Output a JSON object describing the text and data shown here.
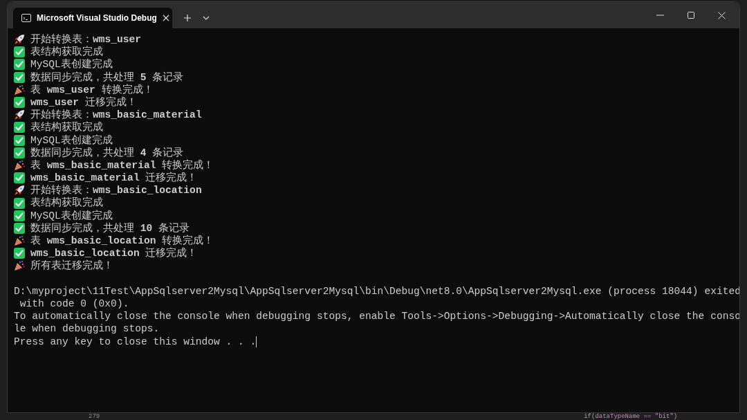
{
  "window": {
    "tab": {
      "title": "Microsoft Visual Studio Debug",
      "selected": true
    }
  },
  "console": {
    "lines": [
      {
        "kind": "rocket",
        "text": "开始转换表：**wms_user**"
      },
      {
        "kind": "check",
        "text": "表结构获取完成"
      },
      {
        "kind": "check",
        "text": "MySQL表创建完成"
      },
      {
        "kind": "check",
        "text": "数据同步完成，共处理 **5** 条记录"
      },
      {
        "kind": "party",
        "text": "表 **wms_user** 转换完成！"
      },
      {
        "kind": "check",
        "text": "**wms_user** 迁移完成！"
      },
      {
        "kind": "rocket",
        "text": "开始转换表：**wms_basic_material**"
      },
      {
        "kind": "check",
        "text": "表结构获取完成"
      },
      {
        "kind": "check",
        "text": "MySQL表创建完成"
      },
      {
        "kind": "check",
        "text": "数据同步完成，共处理 **4** 条记录"
      },
      {
        "kind": "party",
        "text": "表 **wms_basic_material** 转换完成！"
      },
      {
        "kind": "check",
        "text": "**wms_basic_material** 迁移完成！"
      },
      {
        "kind": "rocket",
        "text": "开始转换表：**wms_basic_location**"
      },
      {
        "kind": "check",
        "text": "表结构获取完成"
      },
      {
        "kind": "check",
        "text": "MySQL表创建完成"
      },
      {
        "kind": "check",
        "text": "数据同步完成，共处理 **10** 条记录"
      },
      {
        "kind": "party",
        "text": "表 **wms_basic_location** 转换完成！"
      },
      {
        "kind": "check",
        "text": "**wms_basic_location** 迁移完成！"
      },
      {
        "kind": "party",
        "text": "所有表迁移完成！"
      }
    ],
    "exit_lines": [
      "D:\\myproject\\11Test\\AppSqlserver2Mysql\\AppSqlserver2Mysql\\bin\\Debug\\net8.0\\AppSqlserver2Mysql.exe (process 18044) exited",
      " with code 0 (0x0).",
      "To automatically close the console when debugging stops, enable Tools->Options->Debugging->Automatically close the conso",
      "le when debugging stops.",
      "Press any key to close this window . . ."
    ]
  },
  "editor_behind": {
    "line_number": "279",
    "code": "if(dataTypeName == \"bit\")"
  }
}
